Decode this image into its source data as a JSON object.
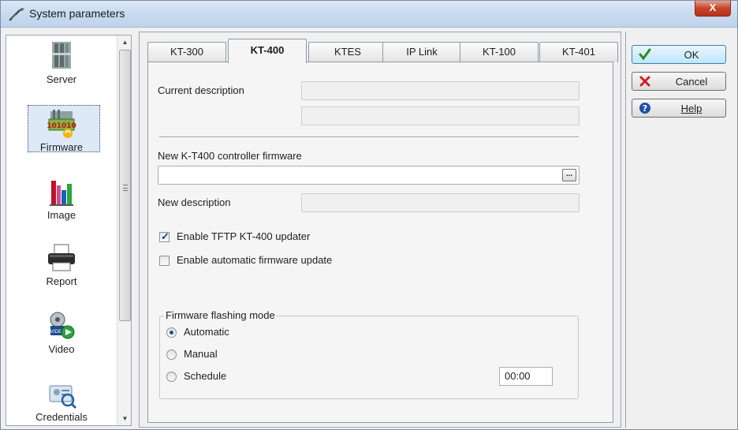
{
  "window": {
    "title": "System parameters",
    "close_label": "X"
  },
  "sidebar": {
    "items": [
      {
        "label": "Server",
        "icon": "server-icon"
      },
      {
        "label": "Firmware",
        "icon": "firmware-icon",
        "selected": true
      },
      {
        "label": "Image",
        "icon": "image-chart-icon"
      },
      {
        "label": "Report",
        "icon": "printer-icon"
      },
      {
        "label": "Video",
        "icon": "video-icon"
      },
      {
        "label": "Credentials",
        "icon": "credentials-icon"
      }
    ]
  },
  "tabs": [
    {
      "label": "KT-300"
    },
    {
      "label": "KT-400",
      "active": true
    },
    {
      "label": "KTES"
    },
    {
      "label": "IP Link"
    },
    {
      "label": "KT-100"
    },
    {
      "label": "KT-401"
    }
  ],
  "panel": {
    "current_description_label": "Current description",
    "current_description_value": "",
    "current_description_value2": "",
    "new_firmware_label": "New K-T400 controller firmware",
    "new_firmware_value": "",
    "browse_label": "...",
    "new_description_label": "New description",
    "new_description_value": "",
    "enable_tftp_label": "Enable TFTP KT-400 updater",
    "enable_tftp_checked": true,
    "enable_auto_label": "Enable automatic firmware update",
    "enable_auto_checked": false,
    "flash_mode": {
      "title": "Firmware flashing mode",
      "options": [
        "Automatic",
        "Manual",
        "Schedule"
      ],
      "selected": "Automatic",
      "schedule_time": "00:00"
    }
  },
  "buttons": {
    "ok": "OK",
    "cancel": "Cancel",
    "help": "Help"
  },
  "colors": {
    "ok_check": "#2e8b1e",
    "cancel_x": "#d01e1e",
    "help": "#1e4fa8"
  }
}
